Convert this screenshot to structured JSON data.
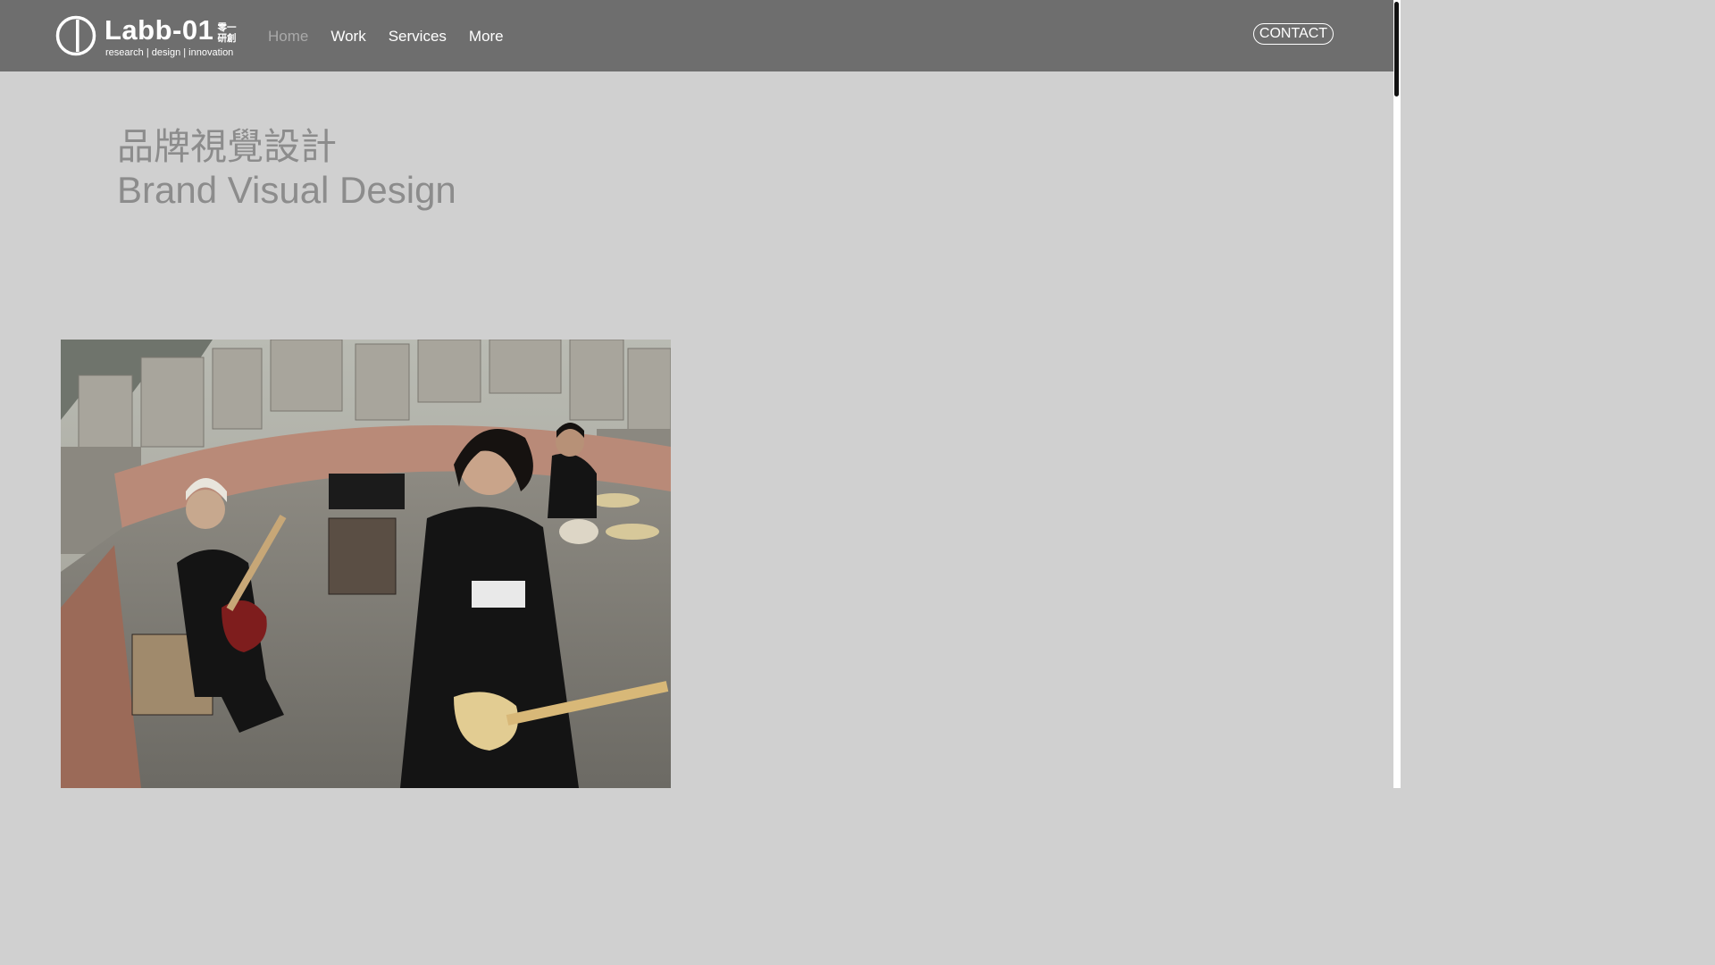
{
  "header": {
    "logo": {
      "wordmark": "Labb-01",
      "cjk": "零一研創",
      "tagline": "research | design | innovation"
    },
    "nav": [
      {
        "label": "Home",
        "active": true
      },
      {
        "label": "Work",
        "active": false
      },
      {
        "label": "Services",
        "active": false
      },
      {
        "label": "More",
        "active": false
      }
    ],
    "contact_label": "CONTACT"
  },
  "hero": {
    "title_cjk": "品牌視覺設計",
    "title_en": "Brand Visual Design"
  },
  "colors": {
    "header_bg": "#6e6e6e",
    "page_bg": "#d0d0d0",
    "title_text": "#8c8c8c",
    "nav_active": "#a9a9a9",
    "nav_text": "#ffffff"
  }
}
